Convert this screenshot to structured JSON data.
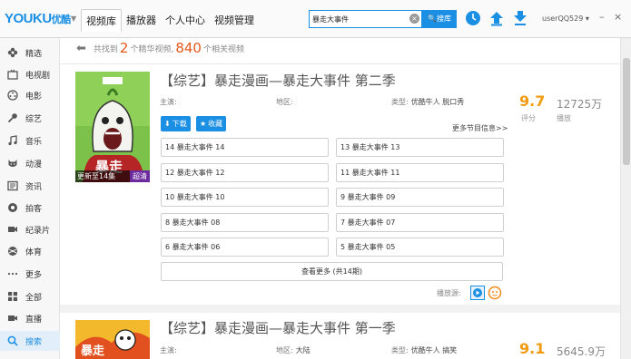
{
  "app": {
    "logo_en": "YOUKU",
    "logo_cn": "优酷"
  },
  "tabs": [
    {
      "label": "视频库"
    },
    {
      "label": "播放器"
    },
    {
      "label": "个人中心"
    },
    {
      "label": "视频管理"
    }
  ],
  "search": {
    "value": "暴走大事件",
    "button": "搜库"
  },
  "user": {
    "name": "userQQ529"
  },
  "sidebar": [
    {
      "label": "精选",
      "icon": "flower-icon"
    },
    {
      "label": "电视剧",
      "icon": "tv-icon"
    },
    {
      "label": "电影",
      "icon": "film-reel-icon"
    },
    {
      "label": "综艺",
      "icon": "microphone-icon"
    },
    {
      "label": "音乐",
      "icon": "music-note-icon"
    },
    {
      "label": "动漫",
      "icon": "cat-face-icon"
    },
    {
      "label": "资讯",
      "icon": "news-icon"
    },
    {
      "label": "拍客",
      "icon": "camera-icon"
    },
    {
      "label": "纪录片",
      "icon": "film-icon"
    },
    {
      "label": "体育",
      "icon": "ball-icon"
    },
    {
      "label": "更多",
      "icon": "ellipsis-icon"
    },
    {
      "label": "全部",
      "icon": "grid-icon"
    },
    {
      "label": "直播",
      "icon": "video-camera-icon"
    },
    {
      "label": "搜索",
      "icon": "search-icon"
    }
  ],
  "results": {
    "prefix": "共找到",
    "featured": "2",
    "mid": "个精华视频,",
    "total": "840",
    "suffix": "个相关视频"
  },
  "cards": [
    {
      "title": "【综艺】暴走漫画—暴走大事件 第二季",
      "host_label": "主演:",
      "host": "",
      "region_label": "地区:",
      "region": "",
      "type_label": "类型:",
      "type": "优酷牛人  脱口秀",
      "score": "9.7",
      "score_label": "评分",
      "plays": "12725万",
      "plays_label": "播放",
      "poster_caption": "更新至14集",
      "poster_tag": "超清",
      "download_label": "下载",
      "favorite_label": "收藏",
      "more_info": "更多节目信息>>",
      "episodes": [
        "14 暴走大事件 14",
        "13 暴走大事件 13",
        "12 暴走大事件 12",
        "11 暴走大事件 11",
        "10 暴走大事件 10",
        "9 暴走大事件 09",
        "8 暴走大事件 08",
        "7 暴走大事件 07",
        "6 暴走大事件 06",
        "5 暴走大事件 05"
      ],
      "view_more": "查看更多 (共14期)",
      "source_label": "播放源:"
    },
    {
      "title": "【综艺】暴走漫画—暴走大事件 第一季",
      "host_label": "主演:",
      "host": "",
      "region_label": "地区:",
      "region": "大陆",
      "type_label": "类型:",
      "type": "优酷牛人  搞笑",
      "score": "9.1",
      "plays": "5645.9万"
    }
  ],
  "colors": {
    "accent": "#1a8fe3",
    "highlight": "#e5581c",
    "score": "#f29b12"
  }
}
